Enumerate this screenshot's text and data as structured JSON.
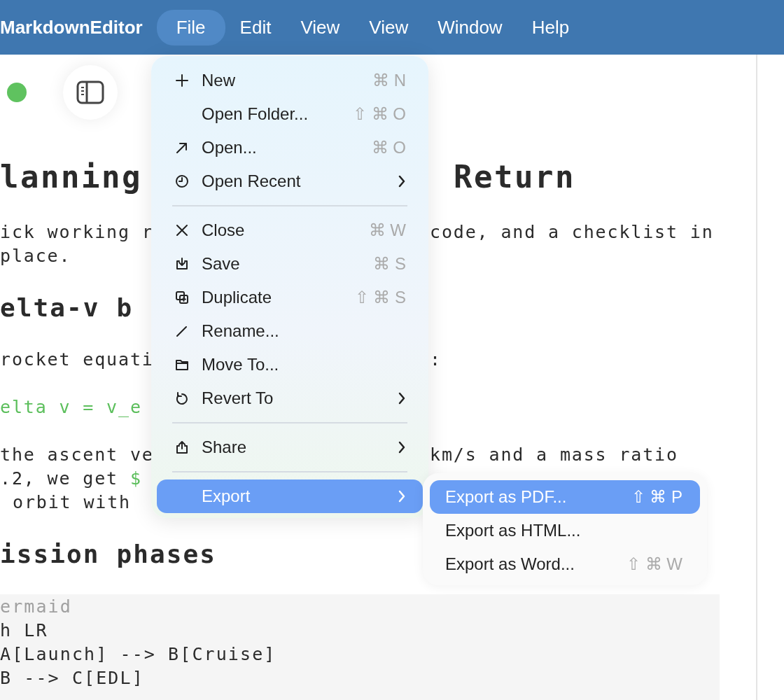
{
  "app": {
    "name": "MarkdownEditor"
  },
  "menubar": [
    {
      "label": "File",
      "selected": true
    },
    {
      "label": "Edit",
      "selected": false
    },
    {
      "label": "View",
      "selected": false
    },
    {
      "label": "View",
      "selected": false
    },
    {
      "label": "Window",
      "selected": false
    },
    {
      "label": "Help",
      "selected": false
    }
  ],
  "document": [
    {
      "kind": "h1",
      "lines": [
        {
          "left": [
            {
              "text": "lanning",
              "math": false
            }
          ],
          "right": [
            {
              "text": "Return",
              "math": false
            }
          ]
        }
      ]
    },
    {
      "kind": "p",
      "lines": [
        {
          "left": [
            {
              "text": "ick working r",
              "math": false
            }
          ],
          "right": [
            {
              "text": "code, and a checklist in",
              "math": false
            }
          ]
        },
        {
          "left": [
            {
              "text": "place.",
              "math": false
            }
          ]
        }
      ]
    },
    {
      "kind": "h2",
      "lines": [
        {
          "left": [
            {
              "text": "elta-v b",
              "math": false
            }
          ]
        }
      ]
    },
    {
      "kind": "p",
      "lines": [
        {
          "left": [
            {
              "text": "rocket equati",
              "math": false
            }
          ],
          "right": [
            {
              "text": ":",
              "math": false
            }
          ]
        }
      ]
    },
    {
      "kind": "p",
      "lines": [
        {
          "left": [
            {
              "text": "elta v = v_e",
              "math": true
            }
          ]
        }
      ]
    },
    {
      "kind": "p",
      "lines": [
        {
          "left": [
            {
              "text": "the ascent ve",
              "math": false
            }
          ],
          "right": [
            {
              "text": "km/s and a mass ratio",
              "math": false
            }
          ]
        },
        {
          "left": [
            {
              "text": ".2, we get ",
              "math": false
            },
            {
              "text": "$",
              "math": true
            }
          ]
        },
        {
          "left": [
            {
              "text": "orbit with",
              "math": false
            }
          ],
          "indent": true
        }
      ]
    },
    {
      "kind": "h2",
      "lines": [
        {
          "left": [
            {
              "text": "ission phases",
              "math": false
            }
          ]
        }
      ]
    },
    {
      "kind": "code",
      "lines": [
        {
          "text": "ermaid",
          "kind": "fence"
        },
        {
          "text": "h LR",
          "kind": "code"
        },
        {
          "text": "A[Launch] --> B[Cruise]",
          "kind": "code"
        },
        {
          "text": "B --> C[EDL]",
          "kind": "code"
        }
      ]
    }
  ],
  "file_menu": [
    {
      "kind": "item",
      "label": "New",
      "shortcut": "⌘ N",
      "submenu": false,
      "selected": false
    },
    {
      "kind": "item",
      "label": "Open Folder...",
      "shortcut": "⇧ ⌘ O",
      "submenu": false,
      "selected": false
    },
    {
      "kind": "item",
      "label": "Open...",
      "shortcut": "⌘ O",
      "submenu": false,
      "selected": false
    },
    {
      "kind": "item",
      "label": "Open Recent",
      "submenu": true,
      "selected": false
    },
    {
      "kind": "separator"
    },
    {
      "kind": "item",
      "label": "Close",
      "shortcut": "⌘ W",
      "submenu": false,
      "selected": false
    },
    {
      "kind": "item",
      "label": "Save",
      "shortcut": "⌘ S",
      "submenu": false,
      "selected": false
    },
    {
      "kind": "item",
      "label": "Duplicate",
      "shortcut": "⇧ ⌘ S",
      "submenu": false,
      "selected": false
    },
    {
      "kind": "item",
      "label": "Rename...",
      "submenu": false,
      "selected": false
    },
    {
      "kind": "item",
      "label": "Move To...",
      "submenu": false,
      "selected": false
    },
    {
      "kind": "item",
      "label": "Revert To",
      "submenu": true,
      "selected": false
    },
    {
      "kind": "separator"
    },
    {
      "kind": "item",
      "label": "Share",
      "submenu": true,
      "selected": false
    },
    {
      "kind": "separator"
    },
    {
      "kind": "item",
      "label": "Export",
      "submenu": true,
      "selected": true
    }
  ],
  "export_submenu": [
    {
      "label": "Export as PDF...",
      "shortcut": "⇧ ⌘ P",
      "selected": true
    },
    {
      "label": "Export as HTML...",
      "selected": false
    },
    {
      "label": "Export as Word...",
      "shortcut": "⇧ ⌘ W",
      "selected": false
    }
  ]
}
